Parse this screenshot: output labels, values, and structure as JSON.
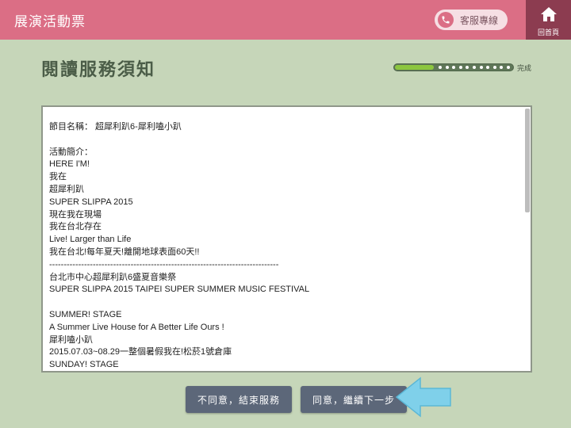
{
  "header": {
    "app_title": "展演活動票",
    "hotline_label": "客服專線",
    "home_label": "回首頁"
  },
  "main": {
    "title": "閱讀服務須知",
    "progress_label": "完成",
    "progress_fraction": 0.33
  },
  "notice": {
    "lines": [
      "節目名稱： 超犀利趴6-犀利嗑小趴",
      "",
      "活動簡介：",
      "HERE I'M!",
      "我在",
      "超犀利趴",
      "SUPER SLIPPA 2015",
      "現在我在現場",
      "我在台北存在",
      "Live! Larger than Life",
      "我在台北!每年夏天!離開地球表面60天!!",
      "-------------------------------------------------------------------------------",
      "台北市中心超犀利趴6盛夏音樂祭",
      "SUPER SLIPPA 2015 TAIPEI SUPER SUMMER MUSIC FESTIVAL",
      "",
      "SUMMER! STAGE",
      "A Summer Live House for A Better Life Ours !",
      "犀利嗑小趴",
      "2015.07.03~08.29一整個暑假我在!松菸1號倉庫",
      "SUNDAY! STAGE"
    ]
  },
  "actions": {
    "disagree_label": "不同意，結束服務",
    "agree_label": "同意，繼續下一步"
  },
  "colors": {
    "header_bg": "#db6e85",
    "home_bg": "#8c3c50",
    "page_bg": "#c6d6b9",
    "button_bg": "#5c6779",
    "progress_fill": "#8cc63f",
    "arrow_hint": "#7fd0ea"
  },
  "icons": {
    "hotline": "phone-icon",
    "home": "home-icon",
    "hint": "arrow-left-icon"
  }
}
